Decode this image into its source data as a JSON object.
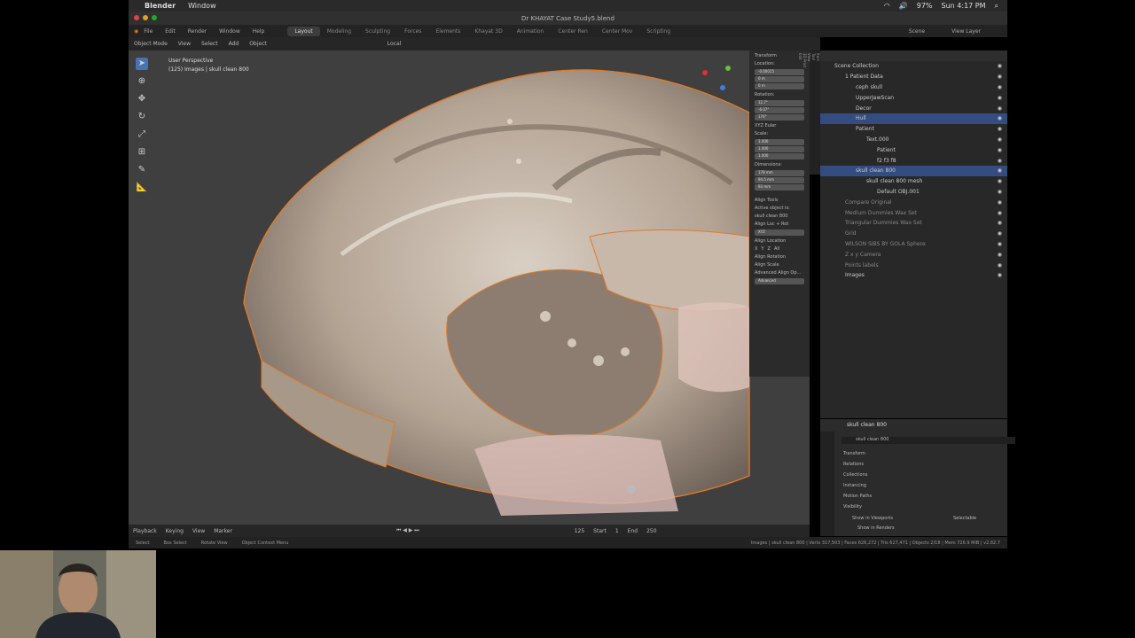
{
  "macos": {
    "app_name": "Blender",
    "menu_window": "Window",
    "battery": "97%",
    "clock": "Sun 4:17 PM"
  },
  "window": {
    "title": "Dr KHAYAT Case Study5.blend"
  },
  "topbar": {
    "menus": [
      "File",
      "Edit",
      "Render",
      "Window",
      "Help"
    ],
    "workspaces": [
      "Layout",
      "Modeling",
      "Sculpting",
      "Forces",
      "Elements",
      "Khayat 3D",
      "Animation",
      "Center Ren",
      "Center Mov",
      "Scripting"
    ],
    "active_workspace": "Layout",
    "scene_label": "Scene",
    "view_layer_label": "View Layer"
  },
  "viewport_header": {
    "mode": "Object Mode",
    "menus": [
      "View",
      "Select",
      "Add",
      "Object"
    ],
    "orientation": "Local"
  },
  "viewport": {
    "view_name": "User Perspective",
    "object_info": "(125) Images | skull clean 800"
  },
  "n_panel": {
    "header": "Transform",
    "location_label": "Location:",
    "location": [
      "-0.00015",
      "0 m",
      "0 m"
    ],
    "rotation_label": "Rotation:",
    "rotation": [
      "12.7°",
      "-6.07°",
      "176°"
    ],
    "euler_label": "XYZ Euler",
    "scale_label": "Scale:",
    "scale": [
      "1.000",
      "1.000",
      "1.000"
    ],
    "dimensions_label": "Dimensions:",
    "dimensions": [
      "178 mm",
      "94.5 mm",
      "93 mm"
    ],
    "align_header": "Align Tools",
    "active_object_label": "Active object is:",
    "active_object": "skull clean 800",
    "align_loc_rot": "Align Loc + Rot",
    "align_loc_rot_value": "XYZ",
    "align_location": "Align Location",
    "align_rotation": "Align Rotation",
    "align_scale": "Align Scale",
    "axis_buttons": [
      "X",
      "Y",
      "Z",
      "All"
    ],
    "advanced": "Advanced Align Op...",
    "advanced_button": "Advanced",
    "tabs": [
      "Item",
      "Tool",
      "View",
      "3D Print",
      "Edit"
    ]
  },
  "outliner": {
    "items": [
      {
        "label": "Scene Collection",
        "indent": 16,
        "state": "normal"
      },
      {
        "label": "1 Patient Data",
        "indent": 28,
        "state": "normal"
      },
      {
        "label": "ceph skull",
        "indent": 40,
        "state": "normal"
      },
      {
        "label": "UpperJawScan",
        "indent": 40,
        "state": "normal"
      },
      {
        "label": "Decor",
        "indent": 40,
        "state": "normal"
      },
      {
        "label": "Hull",
        "indent": 40,
        "state": "selected"
      },
      {
        "label": "Patient",
        "indent": 40,
        "state": "normal"
      },
      {
        "label": "Text.000",
        "indent": 52,
        "state": "normal"
      },
      {
        "label": "Patient",
        "indent": 64,
        "state": "normal"
      },
      {
        "label": "f2 f3 f8",
        "indent": 64,
        "state": "normal"
      },
      {
        "label": "skull clean 800",
        "indent": 40,
        "state": "selected"
      },
      {
        "label": "skull clean 800 mesh",
        "indent": 52,
        "state": "normal"
      },
      {
        "label": "Default OBJ.001",
        "indent": 64,
        "state": "normal"
      },
      {
        "label": "Compare Original",
        "indent": 28,
        "state": "dim"
      },
      {
        "label": "Medium Dummies Wax Set",
        "indent": 28,
        "state": "dim"
      },
      {
        "label": "Triangular Dummies Wax Set",
        "indent": 28,
        "state": "dim"
      },
      {
        "label": "Grid",
        "indent": 28,
        "state": "dim"
      },
      {
        "label": "WILSON SIBS BY GOLA Sphere",
        "indent": 28,
        "state": "dim"
      },
      {
        "label": "Z x y Camera",
        "indent": 28,
        "state": "dim"
      },
      {
        "label": "Points labels",
        "indent": 28,
        "state": "dim"
      },
      {
        "label": "Images",
        "indent": 28,
        "state": "normal"
      }
    ]
  },
  "properties": {
    "title": "skull clean 800",
    "object_name": "skull clean 800",
    "sections": [
      "Transform",
      "Relations",
      "Collections",
      "Instancing",
      "Motion Paths",
      "Visibility"
    ],
    "show_viewports": "Show in Viewports",
    "selectable": "Selectable",
    "show_renders": "Show in Renders"
  },
  "timeline": {
    "menus": [
      "Playback",
      "Keying",
      "View",
      "Marker"
    ],
    "current_frame": "125",
    "start_label": "Start",
    "start": "1",
    "end_label": "End",
    "end": "250"
  },
  "statusbar": {
    "select": "Select",
    "box_select": "Box Select",
    "rotate_view": "Rotate View",
    "context_menu": "Object Context Menu",
    "stats": "Images | skull clean 800 | Verts 317,503 | Faces 626,272 | Tris 627,471 | Objects 2/18 | Mem 726.9 MiB | v2.82.7"
  }
}
